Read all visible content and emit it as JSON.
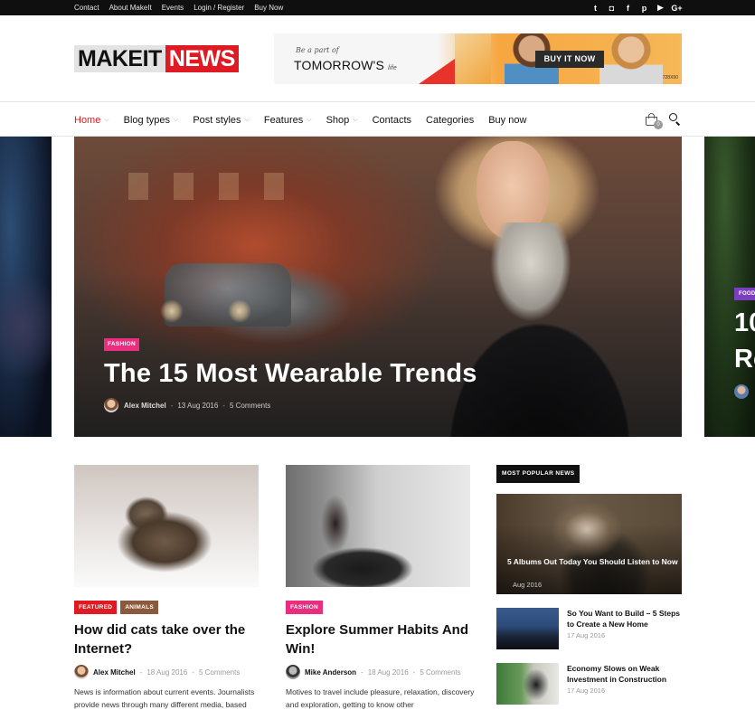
{
  "topbar": {
    "links": [
      "Contact",
      "About MakeIt",
      "Events",
      "Login / Register",
      "Buy Now"
    ],
    "social": [
      {
        "icon": "twitter-icon",
        "glyph": "t"
      },
      {
        "icon": "instagram-icon",
        "glyph": "◘"
      },
      {
        "icon": "facebook-icon",
        "glyph": "f"
      },
      {
        "icon": "pinterest-icon",
        "glyph": "p"
      },
      {
        "icon": "youtube-icon",
        "glyph": "▶"
      },
      {
        "icon": "google-plus-icon",
        "glyph": "G+"
      }
    ]
  },
  "header": {
    "logo_part1": "MAKEIT",
    "logo_part2": "NEWS",
    "ad": {
      "small_text": "Be a part of",
      "big_text": "TOMORROW'S",
      "big_suffix": "life",
      "button": "BUY IT NOW",
      "code": "728X90"
    }
  },
  "nav": {
    "items": [
      {
        "label": "Home",
        "dropdown": true,
        "active": true
      },
      {
        "label": "Blog types",
        "dropdown": true,
        "active": false
      },
      {
        "label": "Post styles",
        "dropdown": true,
        "active": false
      },
      {
        "label": "Features",
        "dropdown": true,
        "active": false
      },
      {
        "label": "Shop",
        "dropdown": true,
        "active": false
      },
      {
        "label": "Contacts",
        "dropdown": false,
        "active": false
      },
      {
        "label": "Categories",
        "dropdown": false,
        "active": false
      },
      {
        "label": "Buy now",
        "dropdown": false,
        "active": false
      }
    ],
    "cart_count": "0",
    "icons": [
      "cart-icon",
      "search-icon"
    ]
  },
  "hero": {
    "category": "FASHION",
    "title": "The 15 Most Wearable Trends",
    "author": "Alex Mitchel",
    "date": "13 Aug 2016",
    "comments": "5 Comments",
    "next_slide": {
      "category": "FOOD",
      "title_line1": "10",
      "title_line2": "Re"
    }
  },
  "posts": [
    {
      "categories": [
        {
          "label": "FEATURED",
          "color": "#e01a22"
        },
        {
          "label": "ANIMALS",
          "color": "#8b5a3c"
        }
      ],
      "title": "How did cats take over the Internet?",
      "author": "Alex Mitchel",
      "date": "18 Aug 2016",
      "comments": "5 Comments",
      "excerpt": "News is information about current events. Journalists provide news through many different media, based"
    },
    {
      "categories": [
        {
          "label": "FASHION",
          "color": "#ea2d7e"
        }
      ],
      "title": "Explore Summer Habits And Win!",
      "author": "Mike Anderson",
      "date": "18 Aug 2016",
      "comments": "5 Comments",
      "excerpt": "Motives to travel include pleasure, relaxation, discovery and exploration, getting to know other"
    }
  ],
  "sidebar": {
    "heading": "MOST POPULAR NEWS",
    "featured": {
      "title": "5 Albums Out Today You Should Listen to Now",
      "date": "Aug 2016"
    },
    "items": [
      {
        "title": "So You Want to Build – 5 Steps to Create a New Home",
        "date": "17 Aug 2016"
      },
      {
        "title": "Economy Slows on Weak Investment in Construction",
        "date": "17 Aug 2016"
      }
    ]
  },
  "colors": {
    "accent": "#e01a22",
    "fashion": "#ea2d7e",
    "food": "#7a3fbf",
    "topbar": "#0f0f0f"
  }
}
